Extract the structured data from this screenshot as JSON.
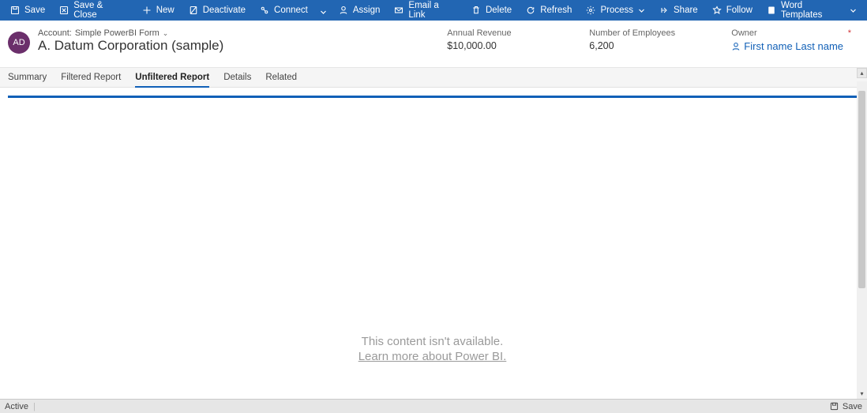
{
  "commandBar": {
    "save": "Save",
    "saveClose": "Save & Close",
    "new": "New",
    "deactivate": "Deactivate",
    "connect": "Connect",
    "assign": "Assign",
    "emailLink": "Email a Link",
    "delete": "Delete",
    "refresh": "Refresh",
    "process": "Process",
    "share": "Share",
    "follow": "Follow",
    "wordTemplates": "Word Templates"
  },
  "header": {
    "avatar": "AD",
    "breadcrumbPrefix": "Account:",
    "breadcrumbForm": "Simple PowerBI Form",
    "title": "A. Datum Corporation (sample)",
    "annualRevenueLabel": "Annual Revenue",
    "annualRevenueValue": "$10,000.00",
    "employeesLabel": "Number of Employees",
    "employeesValue": "6,200",
    "ownerLabel": "Owner",
    "ownerValue": "First name Last name"
  },
  "tabs": {
    "summary": "Summary",
    "filtered": "Filtered Report",
    "unfiltered": "Unfiltered Report",
    "details": "Details",
    "related": "Related"
  },
  "content": {
    "unavailable1": "This content isn't available.",
    "unavailable2": "Learn more about Power BI."
  },
  "statusBar": {
    "status": "Active",
    "save": "Save"
  }
}
